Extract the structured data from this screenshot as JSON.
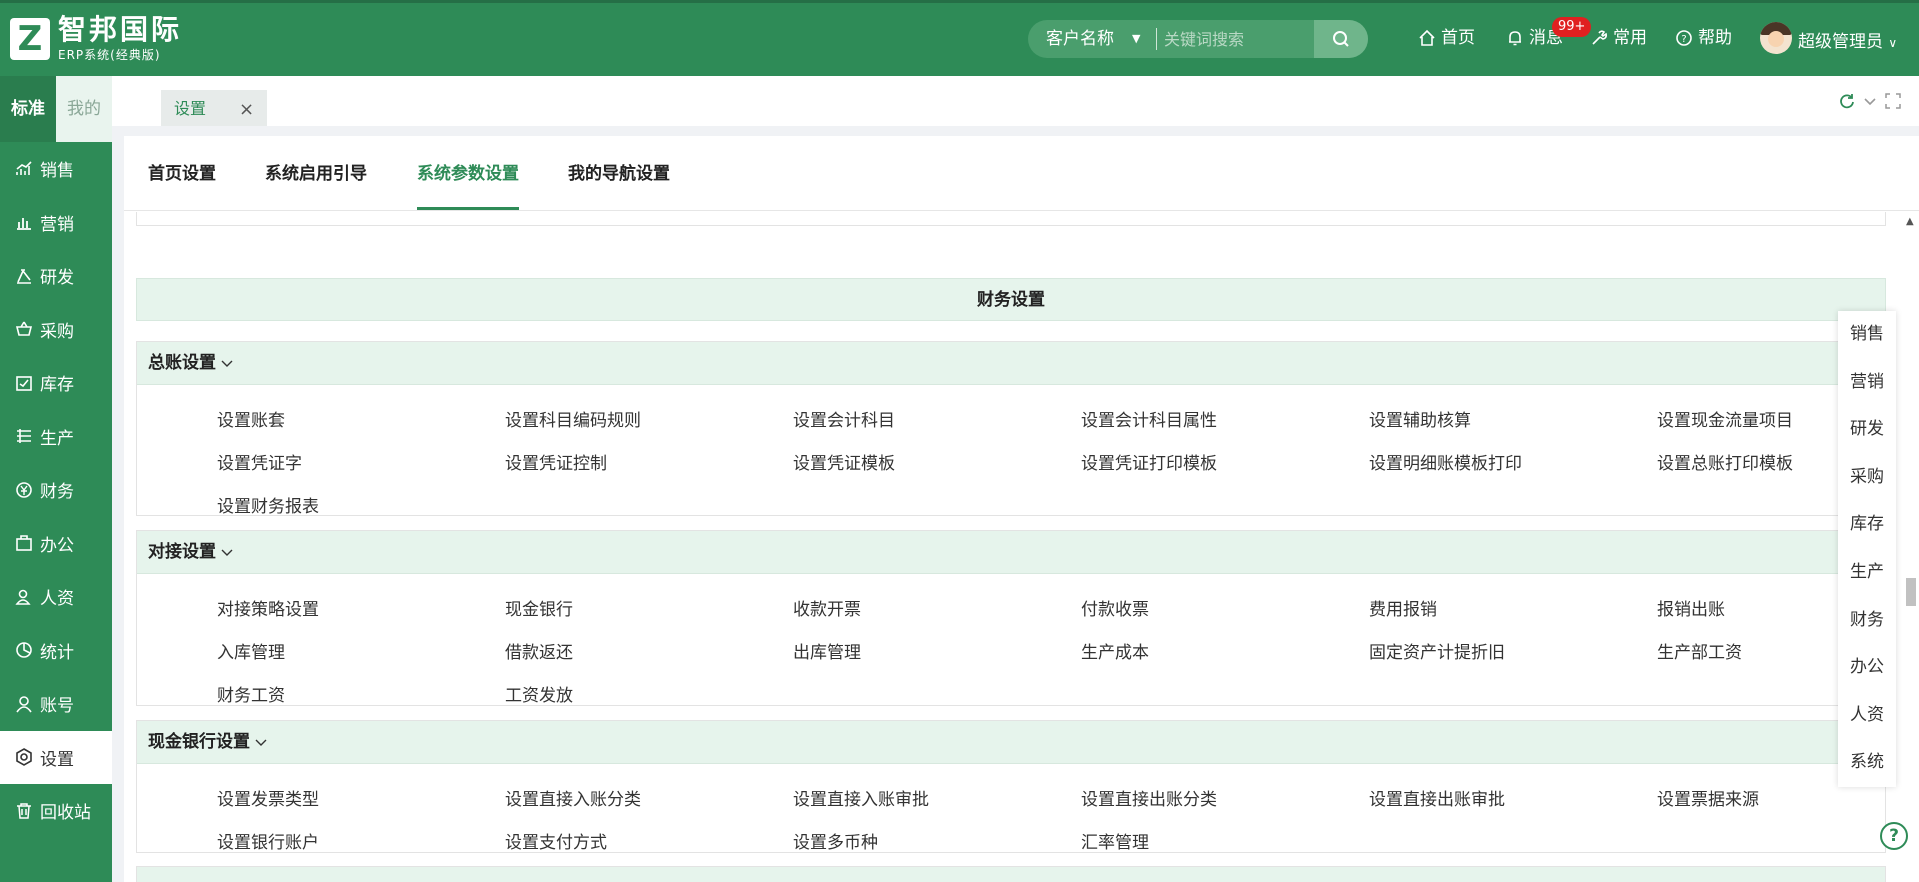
{
  "header": {
    "logo_letter": "Z",
    "brand_title": "智邦国际",
    "brand_subtitle": "ERP系统(经典版)",
    "search": {
      "field_label": "客户名称",
      "placeholder": "关键词搜索",
      "value": ""
    },
    "nav": {
      "home": "首页",
      "messages": "消息",
      "messages_badge": "99+",
      "common": "常用",
      "help": "帮助"
    },
    "user_name": "超级管理员"
  },
  "sidebar": {
    "tabs": [
      "标准",
      "我的"
    ],
    "items": [
      {
        "label": "销售",
        "icon": "sales-chart-icon"
      },
      {
        "label": "营销",
        "icon": "bar-chart-icon"
      },
      {
        "label": "研发",
        "icon": "flask-icon"
      },
      {
        "label": "采购",
        "icon": "basket-icon"
      },
      {
        "label": "库存",
        "icon": "inventory-icon"
      },
      {
        "label": "生产",
        "icon": "production-icon"
      },
      {
        "label": "财务",
        "icon": "yen-icon"
      },
      {
        "label": "办公",
        "icon": "briefcase-icon"
      },
      {
        "label": "人资",
        "icon": "person-icon"
      },
      {
        "label": "统计",
        "icon": "pie-chart-icon"
      },
      {
        "label": "账号",
        "icon": "user-icon"
      },
      {
        "label": "设置",
        "icon": "settings-icon"
      },
      {
        "label": "回收站",
        "icon": "trash-icon"
      }
    ],
    "active": "设置"
  },
  "tabbar": {
    "open_tab": "设置",
    "close_symbol": "×"
  },
  "subtabs": [
    "首页设置",
    "系统启用引导",
    "系统参数设置",
    "我的导航设置"
  ],
  "active_subtab": "系统参数设置",
  "section_title": "财务设置",
  "groups": [
    {
      "title": "总账设置",
      "links": [
        "设置账套",
        "设置科目编码规则",
        "设置会计科目",
        "设置会计科目属性",
        "设置辅助核算",
        "设置现金流量项目",
        "设置凭证字",
        "设置凭证控制",
        "设置凭证模板",
        "设置凭证打印模板",
        "设置明细账模板打印",
        "设置总账打印模板",
        "设置财务报表"
      ]
    },
    {
      "title": "对接设置",
      "links": [
        "对接策略设置",
        "现金银行",
        "收款开票",
        "付款收票",
        "费用报销",
        "报销出账",
        "入库管理",
        "借款返还",
        "出库管理",
        "生产成本",
        "固定资产计提折旧",
        "生产部工资",
        "财务工资",
        "工资发放"
      ]
    },
    {
      "title": "现金银行设置",
      "links": [
        "设置发票类型",
        "设置直接入账分类",
        "设置直接入账审批",
        "设置直接出账分类",
        "设置直接出账审批",
        "设置票据来源",
        "设置银行账户",
        "设置支付方式",
        "设置多币种",
        "汇率管理"
      ]
    }
  ],
  "float_nav": [
    "销售",
    "营销",
    "研发",
    "采购",
    "库存",
    "生产",
    "财务",
    "办公",
    "人资",
    "系统"
  ],
  "help_symbol": "?",
  "colors": {
    "primary": "#2e8b57",
    "light_green": "#e6f4ec",
    "badge": "#e02020"
  }
}
